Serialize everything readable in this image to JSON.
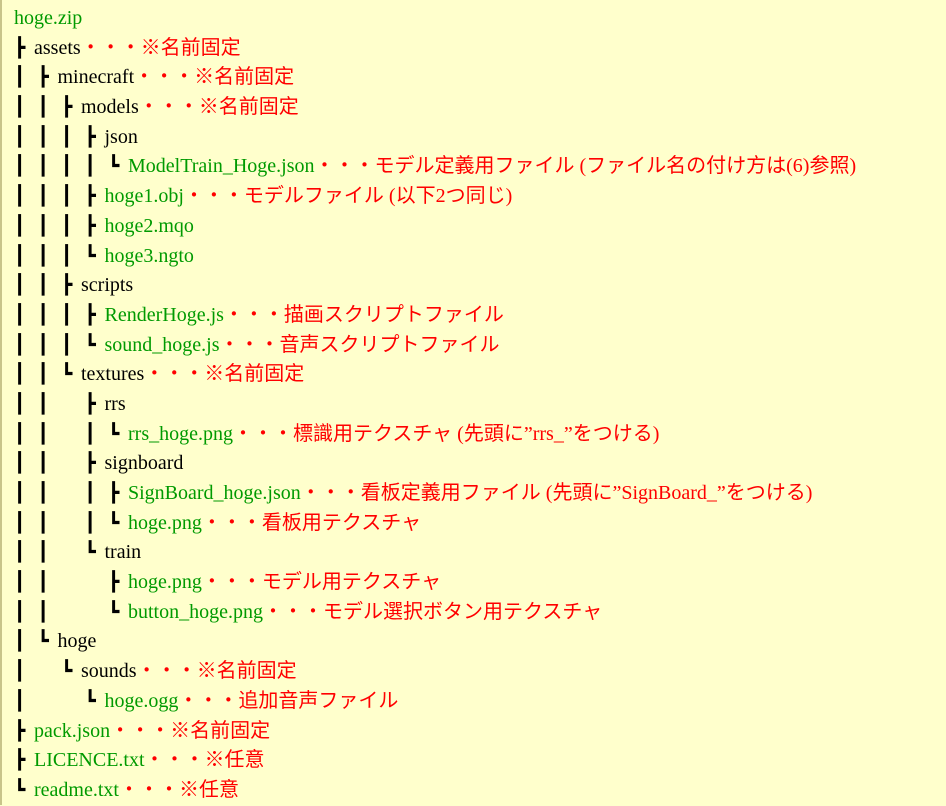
{
  "colors": {
    "background": "#ffffcc",
    "folder_text": "#000000",
    "file_text": "#009a00",
    "description_text": "#ff0000"
  },
  "tree": [
    {
      "depth": 0,
      "branch": "",
      "pipes": [],
      "name": "hoge.zip",
      "kind": "file",
      "desc": ""
    },
    {
      "depth": 1,
      "branch": "┣",
      "pipes": [],
      "name": "assets",
      "kind": "folder",
      "desc": "・・・※名前固定"
    },
    {
      "depth": 2,
      "branch": "┣",
      "pipes": [
        1
      ],
      "name": "minecraft",
      "kind": "folder",
      "desc": "・・・※名前固定"
    },
    {
      "depth": 3,
      "branch": "┣",
      "pipes": [
        1,
        2
      ],
      "name": "models",
      "kind": "folder",
      "desc": "・・・※名前固定"
    },
    {
      "depth": 4,
      "branch": "┣",
      "pipes": [
        1,
        2,
        3
      ],
      "name": "json",
      "kind": "folder",
      "desc": ""
    },
    {
      "depth": 5,
      "branch": "┗",
      "pipes": [
        1,
        2,
        3,
        4
      ],
      "name": "ModelTrain_Hoge.json",
      "kind": "file",
      "desc": "・・・モデル定義用ファイル (ファイル名の付け方は(6)参照)"
    },
    {
      "depth": 4,
      "branch": "┣",
      "pipes": [
        1,
        2,
        3
      ],
      "name": "hoge1.obj",
      "kind": "file",
      "desc": "・・・モデルファイル (以下2つ同じ)"
    },
    {
      "depth": 4,
      "branch": "┣",
      "pipes": [
        1,
        2,
        3
      ],
      "name": "hoge2.mqo",
      "kind": "file",
      "desc": ""
    },
    {
      "depth": 4,
      "branch": "┗",
      "pipes": [
        1,
        2,
        3
      ],
      "name": "hoge3.ngto",
      "kind": "file",
      "desc": ""
    },
    {
      "depth": 3,
      "branch": "┣",
      "pipes": [
        1,
        2
      ],
      "name": "scripts",
      "kind": "folder",
      "desc": ""
    },
    {
      "depth": 4,
      "branch": "┣",
      "pipes": [
        1,
        2,
        3
      ],
      "name": "RenderHoge.js",
      "kind": "file",
      "desc": "・・・描画スクリプトファイル"
    },
    {
      "depth": 4,
      "branch": "┗",
      "pipes": [
        1,
        2,
        3
      ],
      "name": "sound_hoge.js",
      "kind": "file",
      "desc": "・・・音声スクリプトファイル"
    },
    {
      "depth": 3,
      "branch": "┗",
      "pipes": [
        1,
        2
      ],
      "name": "textures",
      "kind": "folder",
      "desc": "・・・※名前固定"
    },
    {
      "depth": 4,
      "branch": "┣",
      "pipes": [
        1,
        2
      ],
      "name": "rrs",
      "kind": "folder",
      "desc": ""
    },
    {
      "depth": 5,
      "branch": "┗",
      "pipes": [
        1,
        2,
        4
      ],
      "name": "rrs_hoge.png",
      "kind": "file",
      "desc": "・・・標識用テクスチャ (先頭に”rrs_”をつける)"
    },
    {
      "depth": 4,
      "branch": "┣",
      "pipes": [
        1,
        2
      ],
      "name": "signboard",
      "kind": "folder",
      "desc": ""
    },
    {
      "depth": 5,
      "branch": "┣",
      "pipes": [
        1,
        2,
        4
      ],
      "name": "SignBoard_hoge.json",
      "kind": "file",
      "desc": "・・・看板定義用ファイル (先頭に”SignBoard_”をつける)"
    },
    {
      "depth": 5,
      "branch": "┗",
      "pipes": [
        1,
        2,
        4
      ],
      "name": "hoge.png",
      "kind": "file",
      "desc": "・・・看板用テクスチャ"
    },
    {
      "depth": 4,
      "branch": "┗",
      "pipes": [
        1,
        2
      ],
      "name": "train",
      "kind": "folder",
      "desc": ""
    },
    {
      "depth": 5,
      "branch": "┣",
      "pipes": [
        1,
        2
      ],
      "name": "hoge.png",
      "kind": "file",
      "desc": "・・・モデル用テクスチャ"
    },
    {
      "depth": 5,
      "branch": "┗",
      "pipes": [
        1,
        2
      ],
      "name": "button_hoge.png",
      "kind": "file",
      "desc": "・・・モデル選択ボタン用テクスチャ"
    },
    {
      "depth": 2,
      "branch": "┗",
      "pipes": [
        1
      ],
      "name": "hoge",
      "kind": "folder",
      "desc": ""
    },
    {
      "depth": 3,
      "branch": "┗",
      "pipes": [
        1
      ],
      "name": "sounds",
      "kind": "folder",
      "desc": "・・・※名前固定"
    },
    {
      "depth": 4,
      "branch": "┗",
      "pipes": [
        1
      ],
      "name": "hoge.ogg",
      "kind": "file",
      "desc": "・・・追加音声ファイル"
    },
    {
      "depth": 1,
      "branch": "┣",
      "pipes": [],
      "name": "pack.json",
      "kind": "file",
      "desc": "・・・※名前固定"
    },
    {
      "depth": 1,
      "branch": "┣",
      "pipes": [],
      "name": "LICENCE.txt",
      "kind": "file",
      "desc": "・・・※任意"
    },
    {
      "depth": 1,
      "branch": "┗",
      "pipes": [],
      "name": "readme.txt",
      "kind": "file",
      "desc": "・・・※任意"
    }
  ]
}
